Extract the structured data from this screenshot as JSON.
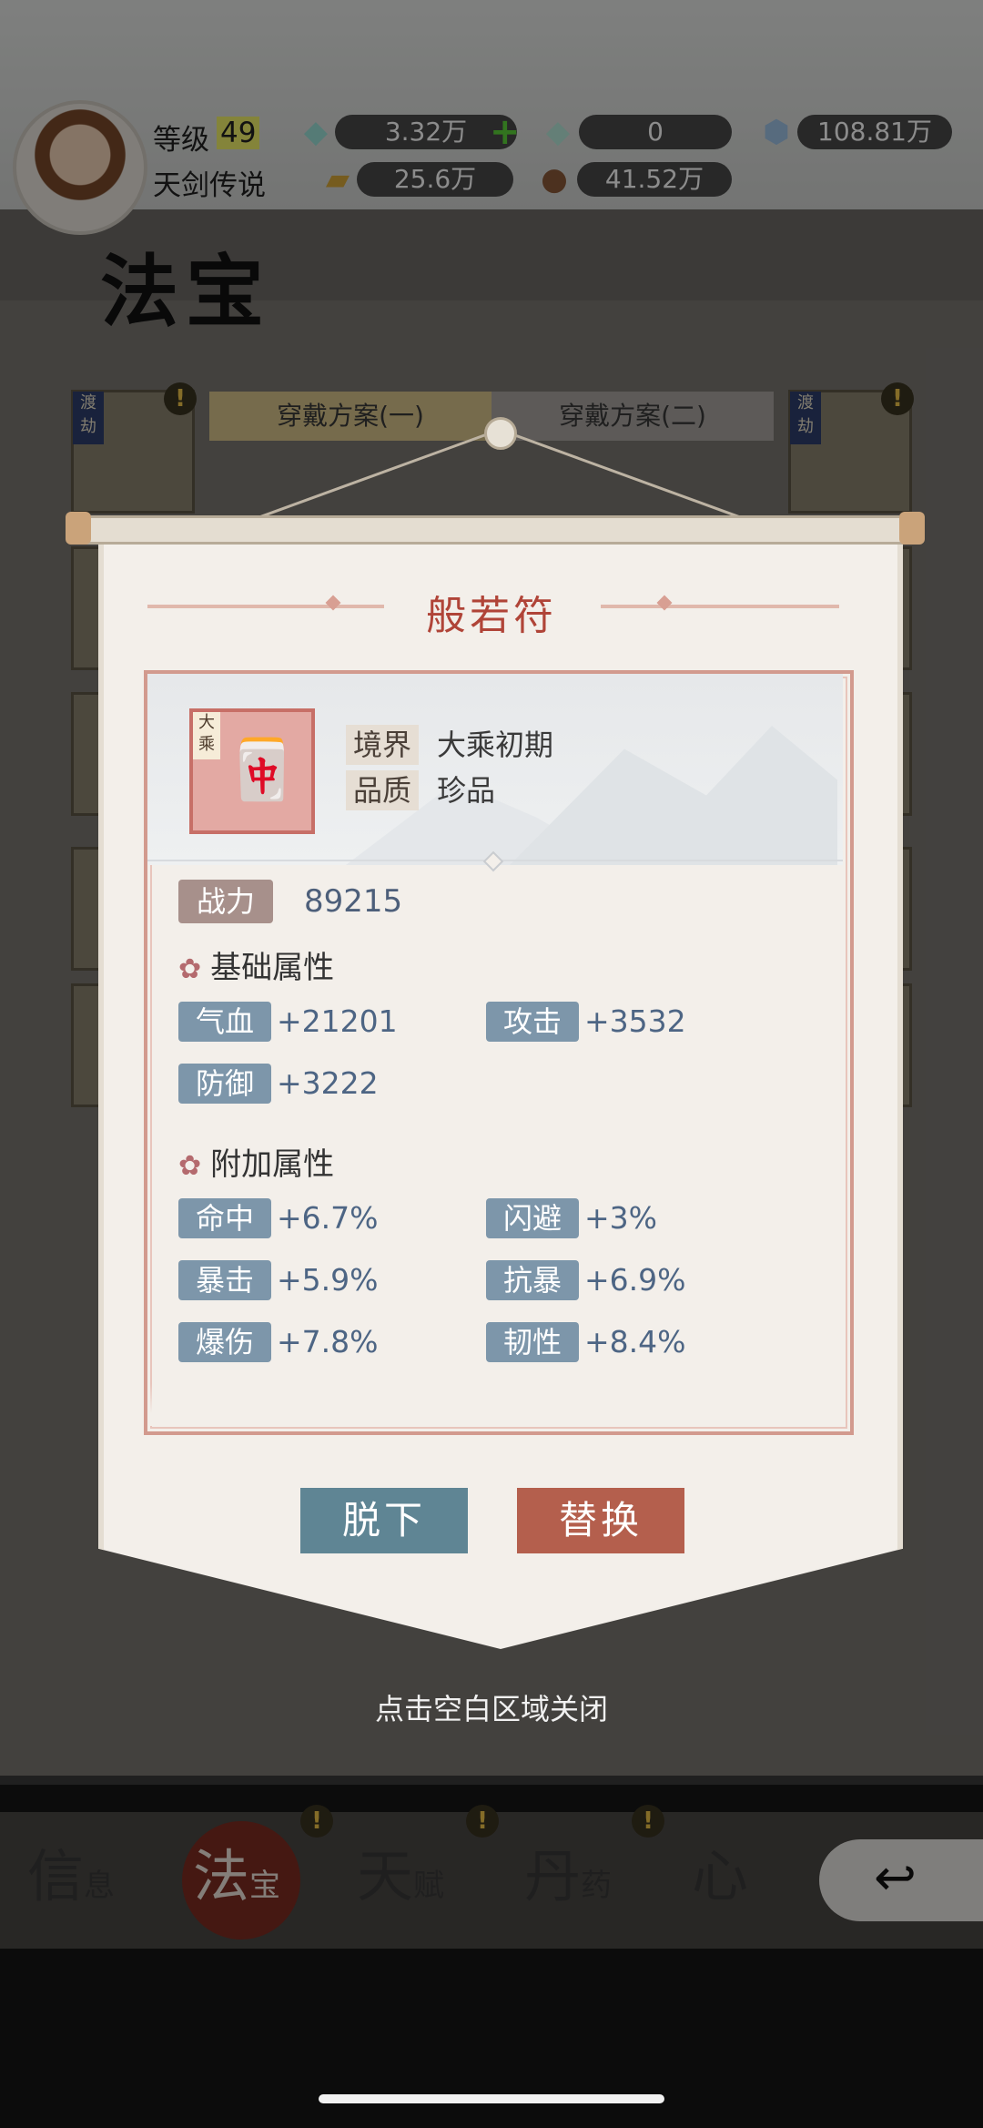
{
  "header": {
    "level_label": "等级",
    "level_value": "49",
    "title": "天剑传说",
    "resources": [
      {
        "icon": "jade-crystal-icon",
        "value": "3.32万",
        "has_plus": true
      },
      {
        "icon": "locked-jade-crystal-icon",
        "value": "0"
      },
      {
        "icon": "spirit-stone-icon",
        "value": "108.81万"
      },
      {
        "icon": "gold-ingot-icon",
        "value": "25.6万"
      },
      {
        "icon": "wood-log-icon",
        "value": "41.52万"
      }
    ]
  },
  "page": {
    "title": "法宝",
    "schemes": [
      "穿戴方案(一)",
      "穿戴方案(二)"
    ],
    "slot_tag": "渡劫"
  },
  "popup": {
    "title": "般若符",
    "item_tag": "大乘",
    "realm_label": "境界",
    "realm_value": "大乘初期",
    "quality_label": "品质",
    "quality_value": "珍品",
    "power_label": "战力",
    "power_value": "89215",
    "base_section": "基础属性",
    "base_stats": [
      {
        "name": "气血",
        "value": "+21201"
      },
      {
        "name": "攻击",
        "value": "+3532"
      },
      {
        "name": "防御",
        "value": "+3222"
      }
    ],
    "extra_section": "附加属性",
    "extra_stats": [
      {
        "name": "命中",
        "value": "+6.7%"
      },
      {
        "name": "闪避",
        "value": "+3%"
      },
      {
        "name": "暴击",
        "value": "+5.9%"
      },
      {
        "name": "抗暴",
        "value": "+6.9%"
      },
      {
        "name": "爆伤",
        "value": "+7.8%"
      },
      {
        "name": "韧性",
        "value": "+8.4%"
      }
    ],
    "buttons": {
      "remove": "脱下",
      "replace": "替换"
    },
    "close_hint": "点击空白区域关闭"
  },
  "tabs": [
    {
      "big": "信",
      "small": "息"
    },
    {
      "big": "法",
      "small": "宝"
    },
    {
      "big": "天",
      "small": "赋"
    },
    {
      "big": "丹",
      "small": "药"
    },
    {
      "big": "心",
      "small": ""
    }
  ],
  "colors": {
    "title_red": "#b04438",
    "stat_key_blue": "#7d96aa",
    "remove_button": "#5f8594",
    "replace_button": "#b45f4d"
  }
}
